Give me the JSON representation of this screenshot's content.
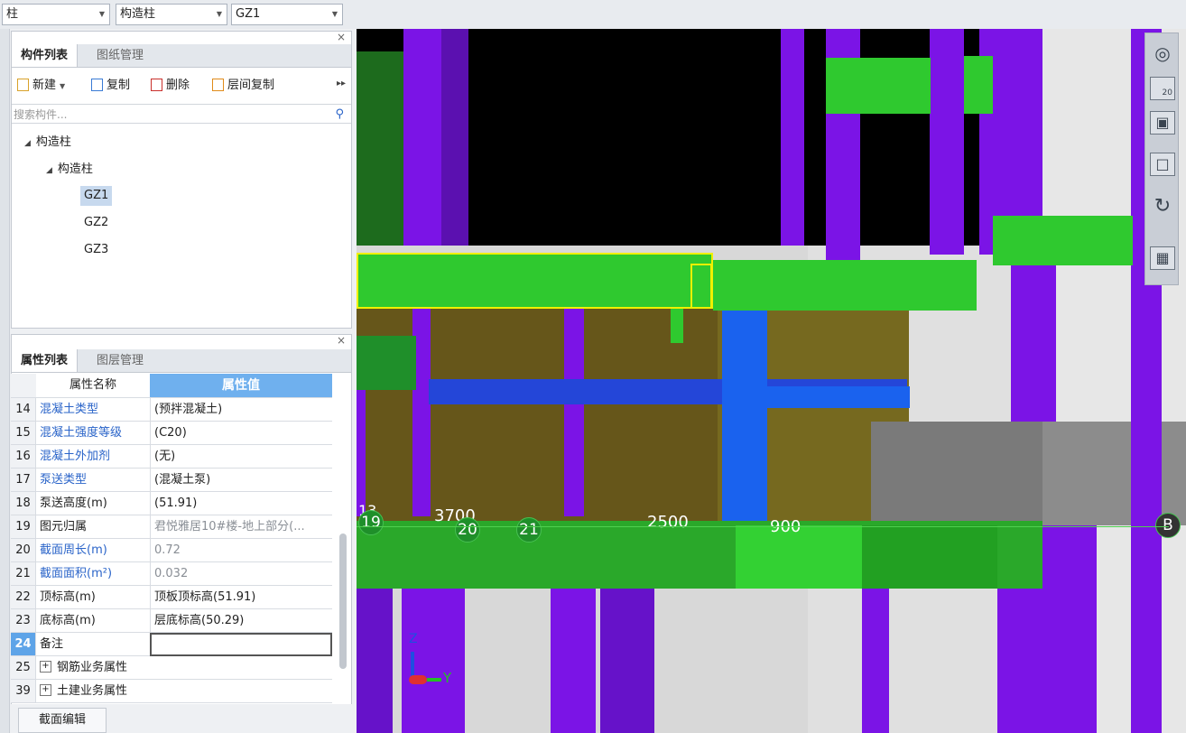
{
  "topbar": {
    "combo1": "柱",
    "combo2": "构造柱",
    "combo3": "GZ1"
  },
  "component_panel": {
    "tabs": [
      "构件列表",
      "图纸管理"
    ],
    "toolbar": {
      "new": "新建",
      "copy": "复制",
      "delete": "删除",
      "floor_copy": "层间复制"
    },
    "search_placeholder": "搜索构件...",
    "tree": {
      "root": "构造柱",
      "child": "构造柱",
      "items": [
        "GZ1",
        "GZ2",
        "GZ3"
      ],
      "selected": "GZ1"
    }
  },
  "property_panel": {
    "tabs": [
      "属性列表",
      "图层管理"
    ],
    "header": {
      "name": "属性名称",
      "value": "属性值"
    },
    "rows": [
      {
        "num": "14",
        "name": "混凝土类型",
        "value": "(预拌混凝土)"
      },
      {
        "num": "15",
        "name": "混凝土强度等级",
        "value": "(C20)"
      },
      {
        "num": "16",
        "name": "混凝土外加剂",
        "value": "(无)"
      },
      {
        "num": "17",
        "name": "泵送类型",
        "value": "(混凝土泵)"
      },
      {
        "num": "18",
        "name": "泵送高度(m)",
        "value": "(51.91)"
      },
      {
        "num": "19",
        "name": "图元归属",
        "value": "君悦雅居10#楼-地上部分(..."
      },
      {
        "num": "20",
        "name": "截面周长(m)",
        "value": "0.72"
      },
      {
        "num": "21",
        "name": "截面面积(m²)",
        "value": "0.032"
      },
      {
        "num": "22",
        "name": "顶标高(m)",
        "value": "顶板顶标高(51.91)"
      },
      {
        "num": "23",
        "name": "底标高(m)",
        "value": "层底标高(50.29)"
      },
      {
        "num": "24",
        "name": "备注",
        "value": ""
      },
      {
        "num": "25",
        "name": "钢筋业务属性",
        "value": ""
      },
      {
        "num": "39",
        "name": "土建业务属性",
        "value": ""
      }
    ],
    "expand_symbol": "+"
  },
  "section_edit_button": "截面编辑",
  "viewport": {
    "labels": {
      "dim_3700": "3700",
      "dim_2500": "2500",
      "dim_900": "900",
      "axis_13": "13",
      "axis_19": "19",
      "axis_20": "20",
      "axis_21": "21",
      "axis_b": "B"
    },
    "gizmo": {
      "z": "Z",
      "y": "Y"
    }
  },
  "right_toolbar": {
    "zoom_badge": "20"
  },
  "colors": {
    "green": "#2fc92f",
    "purple": "#7b14e6",
    "blue": "#1a62ee",
    "olive": "#6e5a1a",
    "gray": "#8a8a8a"
  }
}
